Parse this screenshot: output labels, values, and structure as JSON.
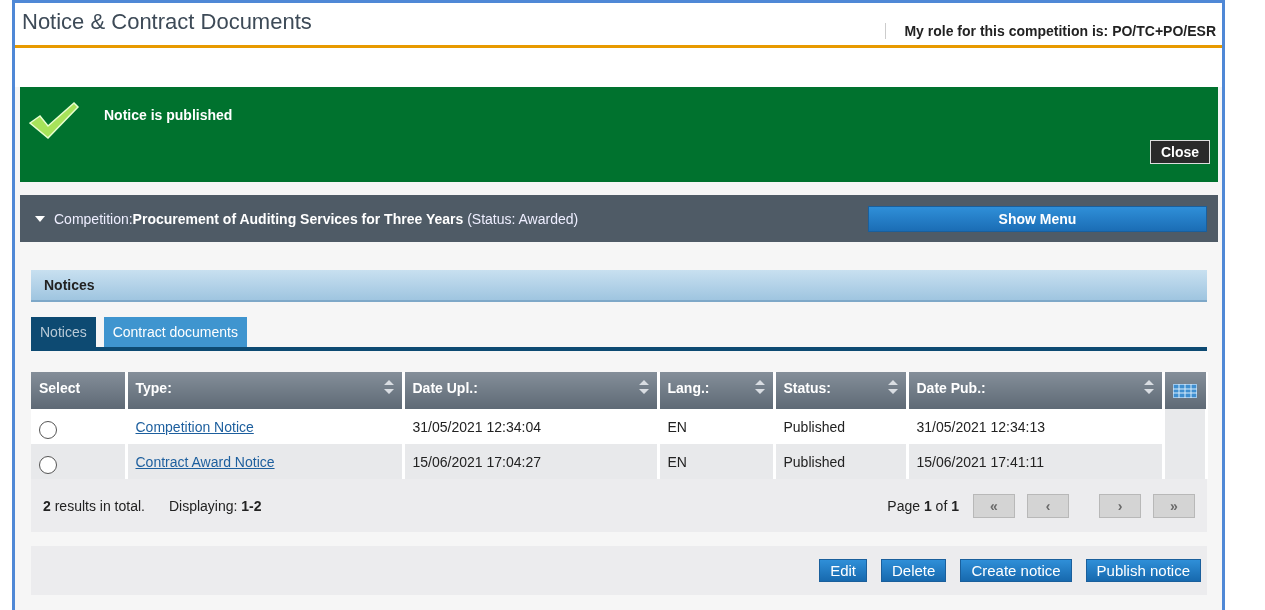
{
  "page": {
    "title": "Notice & Contract Documents",
    "role": "My role for this competition is: PO/TC+PO/ESR"
  },
  "message": {
    "kind": "success",
    "text": "Notice is published",
    "close_button": "Close"
  },
  "competition": {
    "expanded": true,
    "text": "Competition:**Procurement of Auditing Services for Three Years** (Status: Awarded)",
    "menu_button": "Show Menu"
  },
  "panel": {
    "title": "Notices"
  },
  "tabs": [
    {
      "label": "Notices",
      "selected": true
    },
    {
      "label": "Contract documents",
      "selected": false
    }
  ],
  "table": {
    "columns": [
      {
        "label": "Select",
        "sortable": false
      },
      {
        "label": "Type:",
        "sortable": true
      },
      {
        "label": "Date Upl.:",
        "sortable": true
      },
      {
        "label": "Lang.:",
        "sortable": true
      },
      {
        "label": "Status:",
        "sortable": true
      },
      {
        "label": "Date Pub.:",
        "sortable": true
      }
    ],
    "rows": [
      {
        "selected": false,
        "cells": [
          "",
          "Competition Notice",
          "31/05/2021 12:34:04",
          "EN",
          "Published",
          "31/05/2021 12:34:13"
        ]
      },
      {
        "selected": false,
        "cells": [
          "",
          "Contract Award Notice",
          "15/06/2021 17:04:27",
          "EN",
          "Published",
          "15/06/2021 17:41:11"
        ]
      }
    ]
  },
  "summary": {
    "total": "**2** results in total.",
    "displaying": "Displaying: **1-2**",
    "page": "Page **1** of **1**"
  },
  "pager": [
    {
      "label": "«",
      "disabled": true
    },
    {
      "label": "‹",
      "disabled": true
    },
    {
      "label": "›",
      "disabled": true
    },
    {
      "label": "»",
      "disabled": true
    }
  ],
  "actions": [
    "Edit",
    "Delete",
    "Create notice",
    "Publish notice"
  ]
}
